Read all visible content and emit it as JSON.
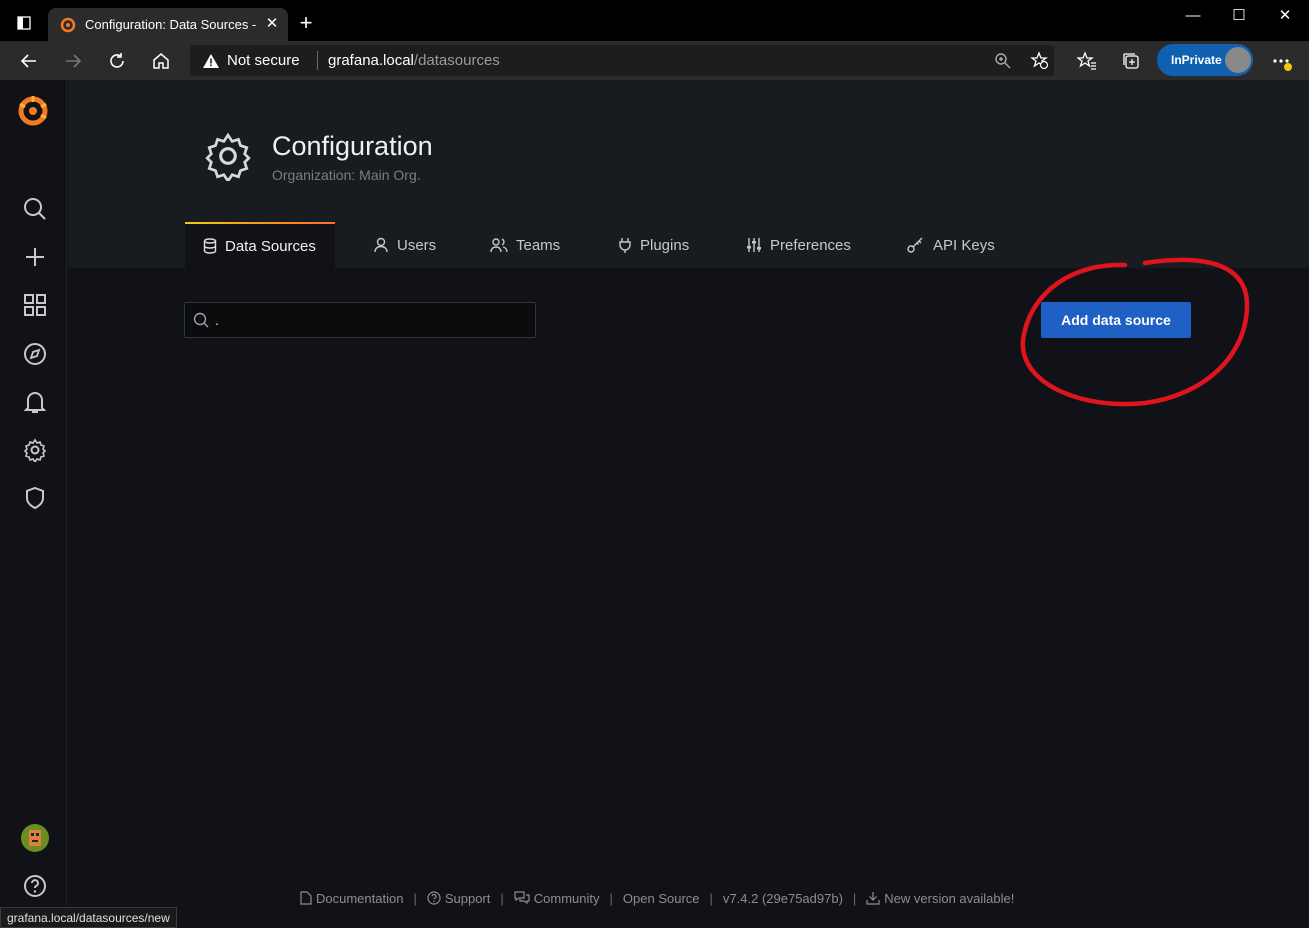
{
  "browser": {
    "tab_title": "Configuration: Data Sources - Gr",
    "security_label": "Not secure",
    "url_host": "grafana.local",
    "url_path": "/datasources",
    "inprivate_label": "InPrivate",
    "status_url": "grafana.local/datasources/new"
  },
  "header": {
    "title": "Configuration",
    "subtitle": "Organization: Main Org."
  },
  "tabs": [
    {
      "label": "Data Sources",
      "icon": "database-icon",
      "active": true
    },
    {
      "label": "Users",
      "icon": "user-icon"
    },
    {
      "label": "Teams",
      "icon": "users-icon"
    },
    {
      "label": "Plugins",
      "icon": "plug-icon"
    },
    {
      "label": "Preferences",
      "icon": "sliders-icon"
    },
    {
      "label": "API Keys",
      "icon": "key-icon"
    }
  ],
  "search": {
    "value": "."
  },
  "add_button_label": "Add data source",
  "footer": {
    "documentation": "Documentation",
    "support": "Support",
    "community": "Community",
    "open_source": "Open Source",
    "version": "v7.4.2 (29e75ad97b)",
    "new_version": "New version available!"
  },
  "colors": {
    "accent_blue": "#1f60c4",
    "annotation_red": "#e0141e",
    "grafana_orange": "#f47a20"
  }
}
